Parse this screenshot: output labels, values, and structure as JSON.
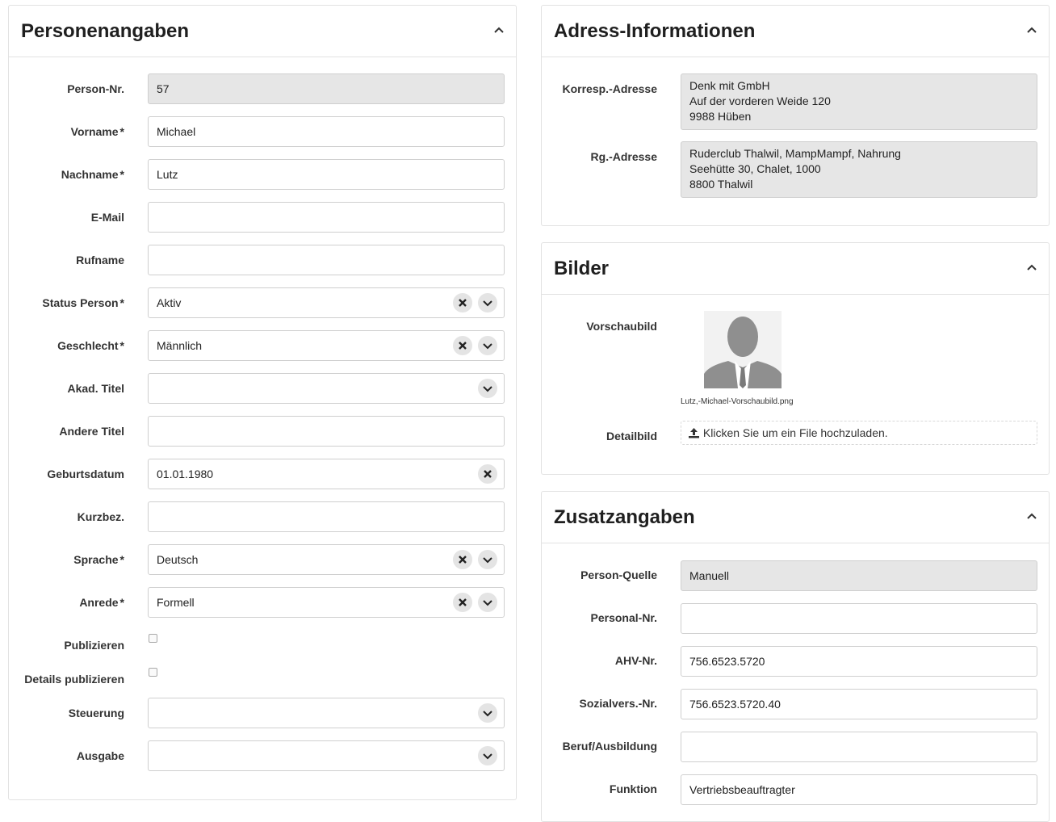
{
  "person": {
    "title": "Personenangaben",
    "fields": {
      "person_nr": {
        "label": "Person-Nr.",
        "value": "57"
      },
      "vorname": {
        "label": "Vorname",
        "required": "*",
        "value": "Michael"
      },
      "nachname": {
        "label": "Nachname",
        "required": "*",
        "value": "Lutz"
      },
      "email": {
        "label": "E-Mail",
        "value": ""
      },
      "rufname": {
        "label": "Rufname",
        "value": ""
      },
      "status": {
        "label": "Status Person",
        "required": "*",
        "value": "Aktiv"
      },
      "geschlecht": {
        "label": "Geschlecht",
        "required": "*",
        "value": "Männlich"
      },
      "akad_titel": {
        "label": "Akad. Titel",
        "value": ""
      },
      "andere_titel": {
        "label": "Andere Titel",
        "value": ""
      },
      "geburtsdatum": {
        "label": "Geburtsdatum",
        "value": "01.01.1980"
      },
      "kurzbez": {
        "label": "Kurzbez.",
        "value": ""
      },
      "sprache": {
        "label": "Sprache",
        "required": "*",
        "value": "Deutsch"
      },
      "anrede": {
        "label": "Anrede",
        "required": "*",
        "value": "Formell"
      },
      "publizieren": {
        "label": "Publizieren",
        "checked": false
      },
      "details_publizieren": {
        "label": "Details publizieren",
        "checked": false
      },
      "steuerung": {
        "label": "Steuerung",
        "value": ""
      },
      "ausgabe": {
        "label": "Ausgabe",
        "value": ""
      }
    }
  },
  "adress": {
    "title": "Adress-Informationen",
    "korresp": {
      "label": "Korresp.-Adresse",
      "lines": [
        "Denk mit GmbH",
        "Auf der vorderen Weide 120",
        "9988 Hüben"
      ]
    },
    "rg": {
      "label": "Rg.-Adresse",
      "lines": [
        "Ruderclub Thalwil, MampMampf, Nahrung",
        "Seehütte 30, Chalet, 1000",
        "8800 Thalwil"
      ]
    }
  },
  "bilder": {
    "title": "Bilder",
    "vorschau": {
      "label": "Vorschaubild",
      "filename": "Lutz,-Michael-Vorschaubild.png"
    },
    "detail": {
      "label": "Detailbild",
      "upload_text": "Klicken Sie um ein File hochzuladen."
    }
  },
  "zusatz": {
    "title": "Zusatzangaben",
    "fields": {
      "quelle": {
        "label": "Person-Quelle",
        "value": "Manuell"
      },
      "personal_nr": {
        "label": "Personal-Nr.",
        "value": ""
      },
      "ahv": {
        "label": "AHV-Nr.",
        "value": "756.6523.5720"
      },
      "sozial": {
        "label": "Sozialvers.-Nr.",
        "value": "756.6523.5720.40"
      },
      "beruf": {
        "label": "Beruf/Ausbildung",
        "value": ""
      },
      "funktion": {
        "label": "Funktion",
        "value": "Vertriebsbeauftragter"
      }
    }
  }
}
